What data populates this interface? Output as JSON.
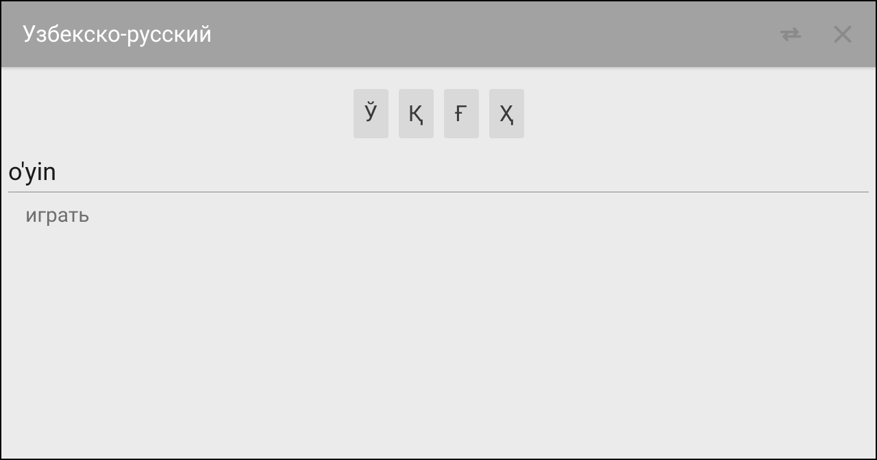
{
  "header": {
    "title": "Узбекско-русский"
  },
  "letters": {
    "0": "Ў",
    "1": "Қ",
    "2": "Ғ",
    "3": "Ҳ"
  },
  "input": {
    "value": "o'yin"
  },
  "suggestion": {
    "text": "играть"
  }
}
